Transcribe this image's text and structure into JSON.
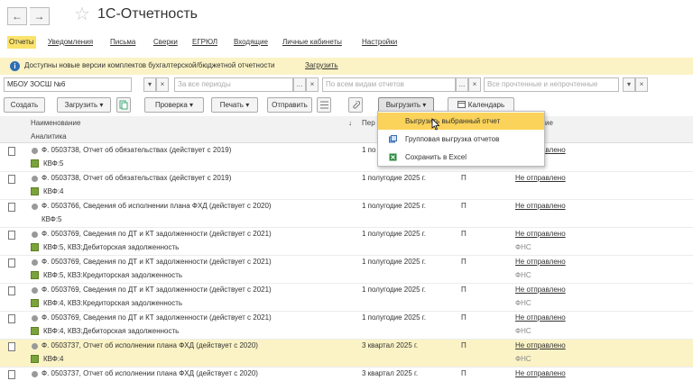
{
  "window": {
    "title": "1С-Отчетность",
    "back": "←",
    "forward": "→",
    "star": "☆"
  },
  "tabs": [
    "Отчеты",
    "Уведомления",
    "Письма",
    "Сверки",
    "ЕГРЮЛ",
    "Входящие",
    "Личные кабинеты",
    "Настройки"
  ],
  "infobar": {
    "icon": "i",
    "text": "Доступны новые версии комплектов бухгалтерской/бюджетной отчетности",
    "link": "Загрузить"
  },
  "filters": {
    "org": "МБОУ ЗОСШ №6",
    "period_placeholder": "За все периоды",
    "types_placeholder": "По всем видам отчетов",
    "state_placeholder": "Все прочтенные и непрочтенные",
    "dots": "...",
    "dropdown": "▾",
    "clear": "×"
  },
  "toolbar": {
    "create": "Создать",
    "load": "Загрузить",
    "check": "Проверка",
    "print": "Печать",
    "send": "Отправить",
    "export": "Выгрузить",
    "calendar": "Календарь",
    "dropdown": "▾"
  },
  "grid": {
    "col_name": "Наименование",
    "col_analytics": "Аналитика",
    "col_period": "Пер",
    "col_status_frag": "ие",
    "sort": "↓"
  },
  "export_menu": [
    {
      "label": "Выгрузить выбранный отчет",
      "icon": "none"
    },
    {
      "label": "Групповая выгрузка отчетов",
      "icon": "group-export-icon"
    },
    {
      "label": "Сохранить в Excel",
      "icon": "excel-icon"
    }
  ],
  "rows": [
    {
      "name": "Ф. 0503738, Отчет об обязательствах (действует с 2019)",
      "analytics": "КВФ:5",
      "period": "1 по",
      "type": "",
      "status": "Не отправлено",
      "recipient": "",
      "selected": false,
      "sub_icon": true
    },
    {
      "name": "Ф. 0503738, Отчет об обязательствах (действует с 2019)",
      "analytics": "КВФ:4",
      "period": "1 полугодие 2025 г.",
      "type": "П",
      "status": "Не отправлено",
      "recipient": "",
      "selected": false,
      "sub_icon": true
    },
    {
      "name": "Ф. 0503766, Сведения об исполнении плана ФХД (действует с 2020)",
      "analytics": "КВФ:5",
      "period": "1 полугодие 2025 г.",
      "type": "П",
      "status": "Не отправлено",
      "recipient": "",
      "selected": false,
      "sub_icon": false
    },
    {
      "name": "Ф. 0503769, Сведения по ДТ и КТ задолженности (действует с 2021)",
      "analytics": "КВФ:5, КВЗ:Дебиторская задолженность",
      "period": "1 полугодие 2025 г.",
      "type": "П",
      "status": "Не отправлено",
      "recipient": "ФНС",
      "selected": false,
      "sub_icon": true
    },
    {
      "name": "Ф. 0503769, Сведения по ДТ и КТ задолженности (действует с 2021)",
      "analytics": "КВФ:5, КВЗ:Кредиторская задолженность",
      "period": "1 полугодие 2025 г.",
      "type": "П",
      "status": "Не отправлено",
      "recipient": "ФНС",
      "selected": false,
      "sub_icon": true
    },
    {
      "name": "Ф. 0503769, Сведения по ДТ и КТ задолженности (действует с 2021)",
      "analytics": "КВФ:4, КВЗ:Кредиторская задолженность",
      "period": "1 полугодие 2025 г.",
      "type": "П",
      "status": "Не отправлено",
      "recipient": "ФНС",
      "selected": false,
      "sub_icon": true
    },
    {
      "name": "Ф. 0503769, Сведения по ДТ и КТ задолженности (действует с 2021)",
      "analytics": "КВФ:4, КВЗ:Дебиторская задолженность",
      "period": "1 полугодие 2025 г.",
      "type": "П",
      "status": "Не отправлено",
      "recipient": "ФНС",
      "selected": false,
      "sub_icon": true
    },
    {
      "name": "Ф. 0503737, Отчет об исполнении плана ФХД (действует с 2020)",
      "analytics": "КВФ:4",
      "period": "3 квартал 2025 г.",
      "type": "П",
      "status": "Не отправлено",
      "recipient": "ФНС",
      "selected": true,
      "sub_icon": true
    },
    {
      "name": "Ф. 0503737, Отчет об исполнении плана ФХД (действует с 2020)",
      "analytics": "",
      "period": "3 квартал 2025 г.",
      "type": "П",
      "status": "Не отправлено",
      "recipient": "",
      "selected": false,
      "sub_icon": false
    }
  ],
  "colors": {
    "accent": "#fbe36b",
    "infobar": "#fbf3c6",
    "menu_highlight": "#fbd35a"
  }
}
